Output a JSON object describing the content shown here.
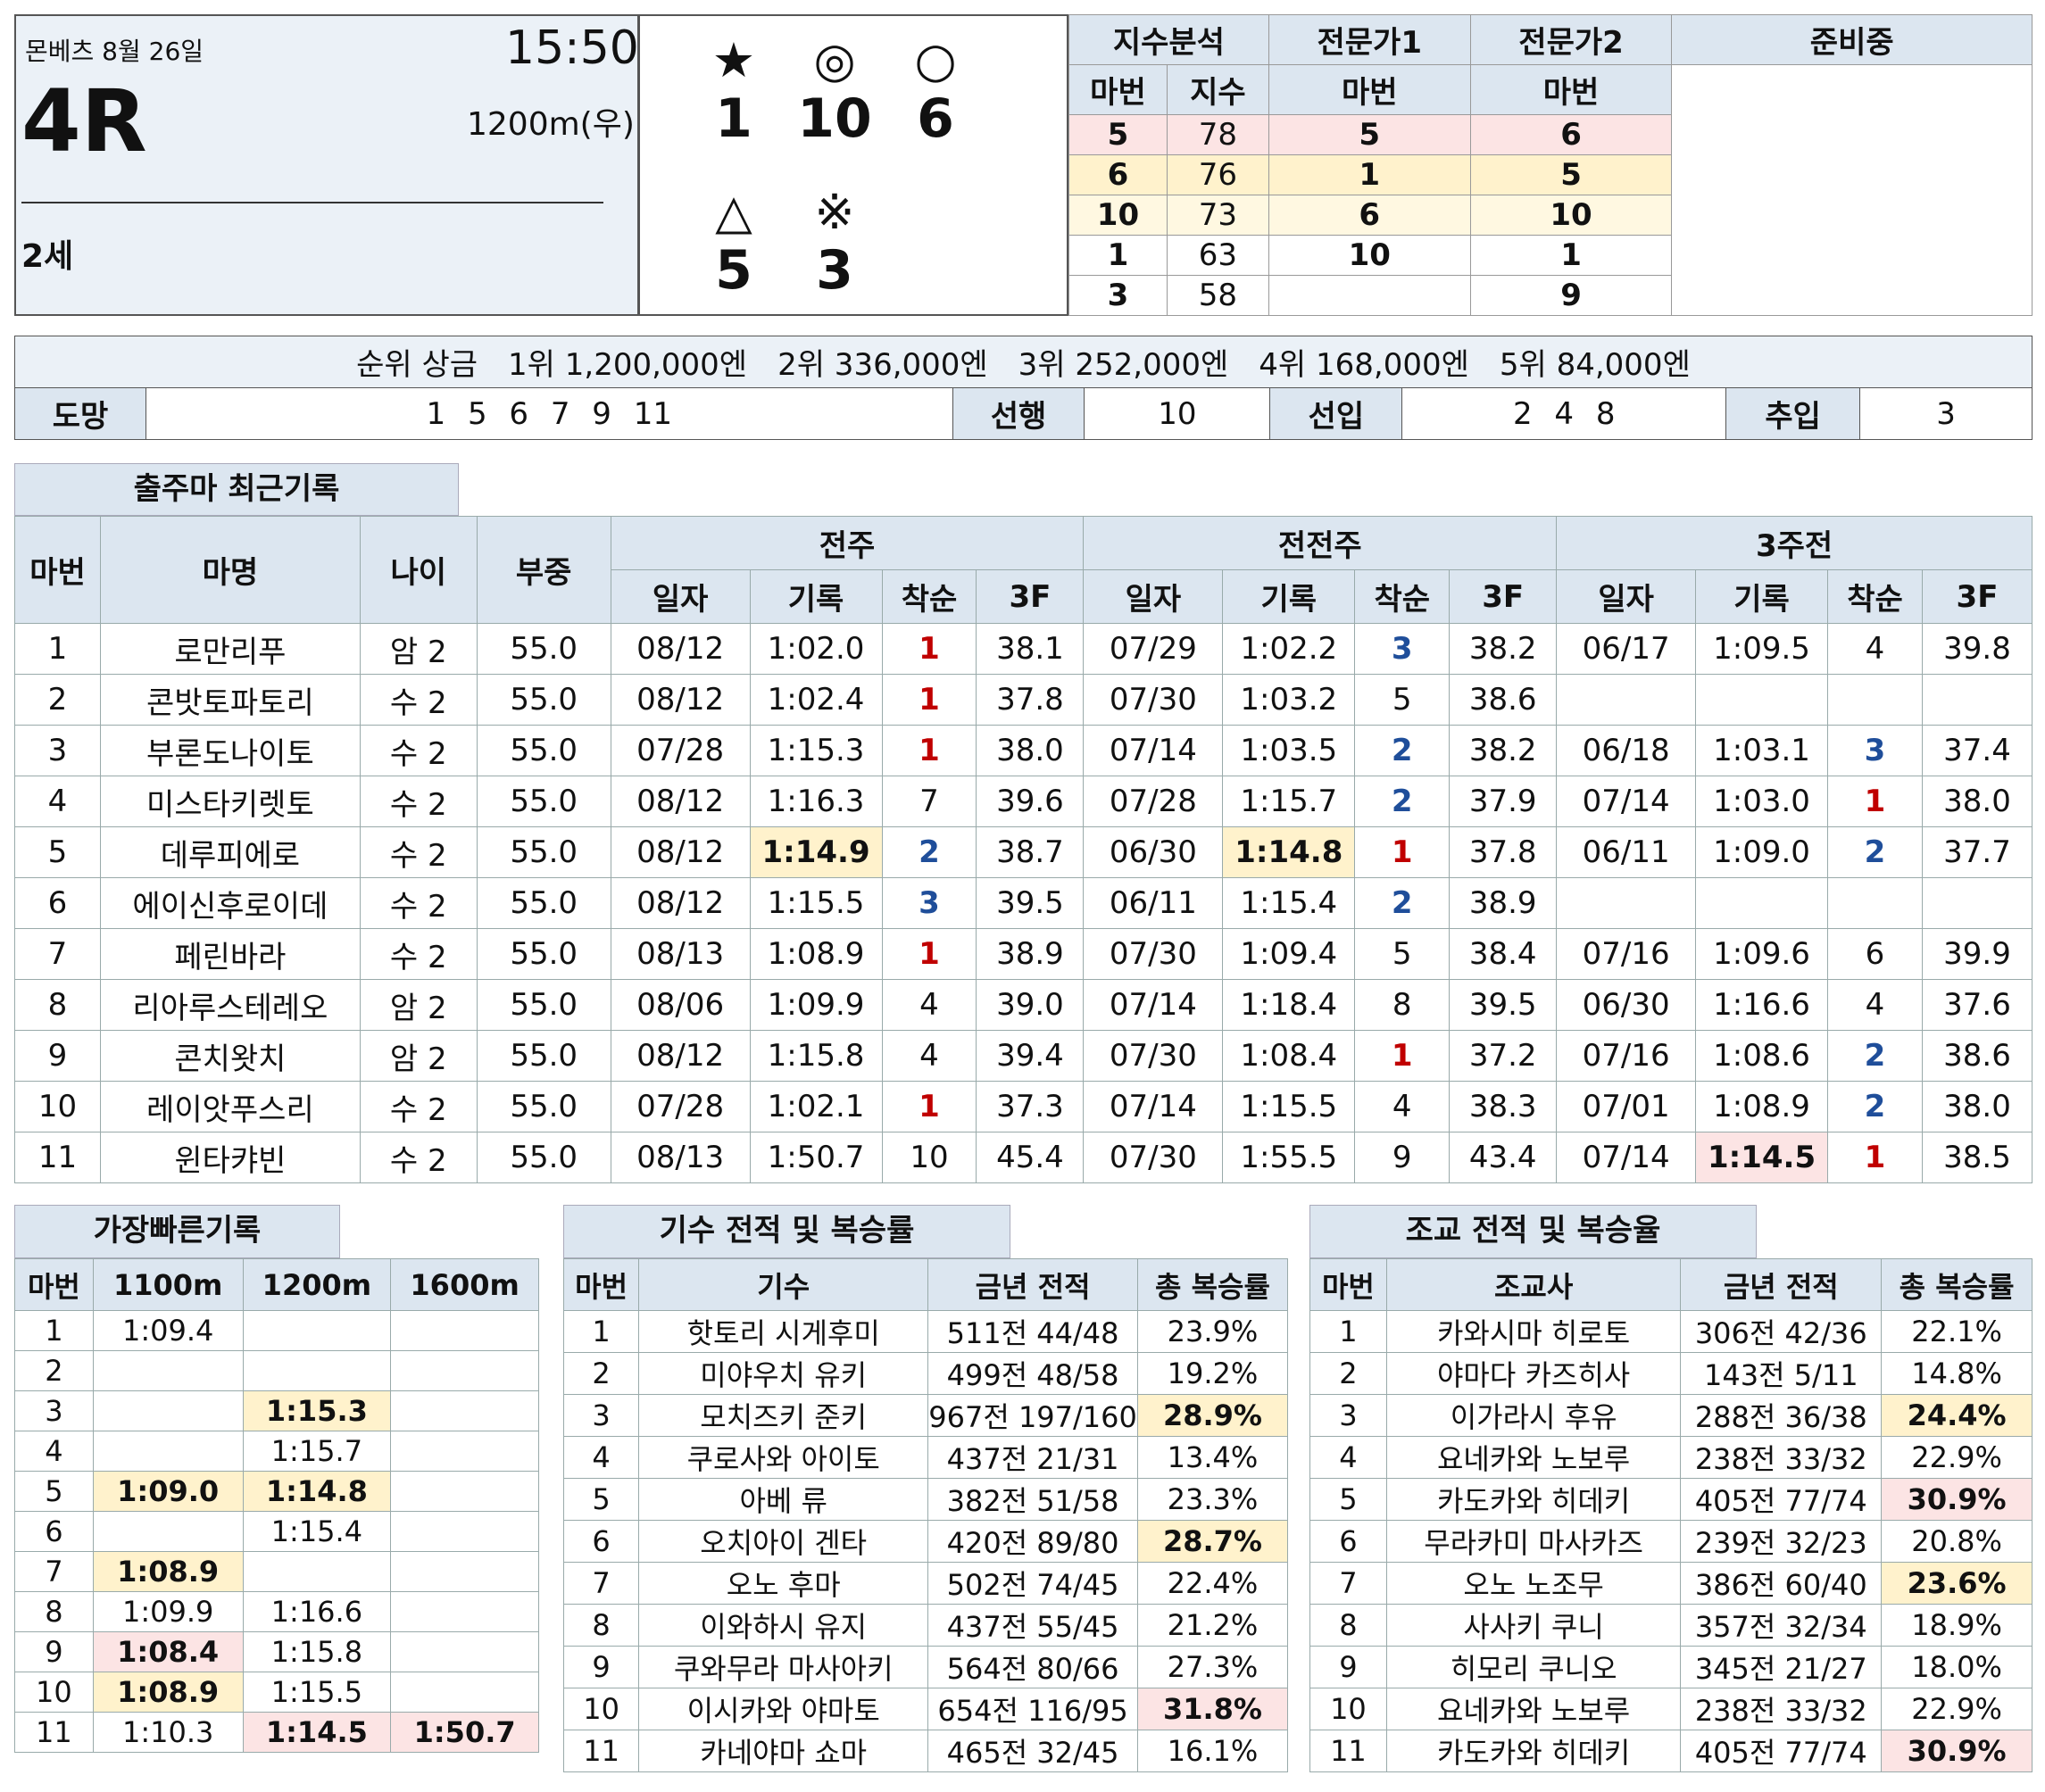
{
  "race": {
    "venue_date": "몬베츠 8월 26일",
    "time": "15:50",
    "race_no": "4R",
    "distance": "1200m(우)",
    "age": "2세"
  },
  "picks": {
    "star_symbol": "★",
    "star_num": "1",
    "double_circle_symbol": "◎",
    "double_circle_num": "10",
    "circle_symbol": "○",
    "circle_num": "6",
    "triangle_symbol": "△",
    "triangle_num": "5",
    "ref_symbol": "※",
    "ref_num": "3"
  },
  "analysis": {
    "headers": [
      "지수분석",
      "전문가1",
      "전문가2",
      "준비중"
    ],
    "sub_headers": [
      "마번",
      "지수",
      "마번",
      "마번"
    ],
    "rows": [
      [
        "5",
        "78",
        "5",
        "6"
      ],
      [
        "6",
        "76",
        "1",
        "5"
      ],
      [
        "10",
        "73",
        "6",
        "10"
      ],
      [
        "1",
        "63",
        "10",
        "1"
      ],
      [
        "3",
        "58",
        "",
        "9"
      ]
    ]
  },
  "prize": {
    "text": "순위 상금　1위 1,200,000엔　2위 336,000엔　3위 252,000엔　4위 168,000엔　5위 84,000엔"
  },
  "pace": {
    "escape_label": "도망",
    "escape_value": "1 5 6 7 9 11",
    "lead_label": "선행",
    "lead_value": "10",
    "stalk_label": "선입",
    "stalk_value": "2 4 8",
    "close_label": "추입",
    "close_value": "3"
  },
  "recent": {
    "title": "출주마 최근기록",
    "col_no": "마번",
    "col_name": "마명",
    "col_age": "나이",
    "col_weight": "부중",
    "period1": "전주",
    "period2": "전전주",
    "period3": "3주전",
    "sub": [
      "일자",
      "기록",
      "착순",
      "3F"
    ],
    "rows": [
      [
        "1",
        "로만리푸",
        "암 2",
        "55.0",
        "08/12",
        "1:02.0",
        "1",
        "38.1",
        "07/29",
        "1:02.2",
        "3",
        "38.2",
        "06/17",
        "1:09.5",
        "4",
        "39.8"
      ],
      [
        "2",
        "콘밧토파토리",
        "수 2",
        "55.0",
        "08/12",
        "1:02.4",
        "1",
        "37.8",
        "07/30",
        "1:03.2",
        "5",
        "38.6",
        "",
        "",
        "",
        ""
      ],
      [
        "3",
        "부론도나이토",
        "수 2",
        "55.0",
        "07/28",
        "1:15.3",
        "1",
        "38.0",
        "07/14",
        "1:03.5",
        "2",
        "38.2",
        "06/18",
        "1:03.1",
        "3",
        "37.4"
      ],
      [
        "4",
        "미스타키렛토",
        "수 2",
        "55.0",
        "08/12",
        "1:16.3",
        "7",
        "39.6",
        "07/28",
        "1:15.7",
        "2",
        "37.9",
        "07/14",
        "1:03.0",
        "1",
        "38.0"
      ],
      [
        "5",
        "데루피에로",
        "수 2",
        "55.0",
        "08/12",
        "1:14.9",
        "2",
        "38.7",
        "06/30",
        "1:14.8",
        "1",
        "37.8",
        "06/11",
        "1:09.0",
        "2",
        "37.7"
      ],
      [
        "6",
        "에이신후로이데",
        "수 2",
        "55.0",
        "08/12",
        "1:15.5",
        "3",
        "39.5",
        "06/11",
        "1:15.4",
        "2",
        "38.9",
        "",
        "",
        "",
        ""
      ],
      [
        "7",
        "페린바라",
        "수 2",
        "55.0",
        "08/13",
        "1:08.9",
        "1",
        "38.9",
        "07/30",
        "1:09.4",
        "5",
        "38.4",
        "07/16",
        "1:09.6",
        "6",
        "39.9"
      ],
      [
        "8",
        "리아루스테레오",
        "암 2",
        "55.0",
        "08/06",
        "1:09.9",
        "4",
        "39.0",
        "07/14",
        "1:18.4",
        "8",
        "39.5",
        "06/30",
        "1:16.6",
        "4",
        "37.6"
      ],
      [
        "9",
        "콘치왓치",
        "암 2",
        "55.0",
        "08/12",
        "1:15.8",
        "4",
        "39.4",
        "07/30",
        "1:08.4",
        "1",
        "37.2",
        "07/16",
        "1:08.6",
        "2",
        "38.6"
      ],
      [
        "10",
        "레이앗푸스리",
        "수 2",
        "55.0",
        "07/28",
        "1:02.1",
        "1",
        "37.3",
        "07/14",
        "1:15.5",
        "4",
        "38.3",
        "07/01",
        "1:08.9",
        "2",
        "38.0"
      ],
      [
        "11",
        "윈타캬빈",
        "수 2",
        "55.0",
        "08/13",
        "1:50.7",
        "10",
        "45.4",
        "07/30",
        "1:55.5",
        "9",
        "43.4",
        "07/14",
        "1:14.5",
        "1",
        "38.5"
      ]
    ]
  },
  "fastest": {
    "title": "가장빠른기록",
    "headers": [
      "마번",
      "1100m",
      "1200m",
      "1600m"
    ],
    "rows": [
      [
        "1",
        "1:09.4",
        "",
        ""
      ],
      [
        "2",
        "",
        "",
        ""
      ],
      [
        "3",
        "",
        "1:15.3",
        ""
      ],
      [
        "4",
        "",
        "1:15.7",
        ""
      ],
      [
        "5",
        "1:09.0",
        "1:14.8",
        ""
      ],
      [
        "6",
        "",
        "1:15.4",
        ""
      ],
      [
        "7",
        "1:08.9",
        "",
        ""
      ],
      [
        "8",
        "1:09.9",
        "1:16.6",
        ""
      ],
      [
        "9",
        "1:08.4",
        "1:15.8",
        ""
      ],
      [
        "10",
        "1:08.9",
        "1:15.5",
        ""
      ],
      [
        "11",
        "1:10.3",
        "1:14.5",
        "1:50.7"
      ]
    ]
  },
  "jockey": {
    "title": "기수 전적 및 복승률",
    "headers": [
      "마번",
      "기수",
      "금년 전적",
      "총 복승률"
    ],
    "rows": [
      [
        "1",
        "핫토리 시게후미",
        "511전 44/48",
        "23.9%"
      ],
      [
        "2",
        "미야우치 유키",
        "499전 48/58",
        "19.2%"
      ],
      [
        "3",
        "모치즈키 준키",
        "967전 197/160",
        "28.9%"
      ],
      [
        "4",
        "쿠로사와 아이토",
        "437전 21/31",
        "13.4%"
      ],
      [
        "5",
        "아베 류",
        "382전 51/58",
        "23.3%"
      ],
      [
        "6",
        "오치아이 겐타",
        "420전 89/80",
        "28.7%"
      ],
      [
        "7",
        "오노 후마",
        "502전 74/45",
        "22.4%"
      ],
      [
        "8",
        "이와하시 유지",
        "437전 55/45",
        "21.2%"
      ],
      [
        "9",
        "쿠와무라 마사아키",
        "564전 80/66",
        "27.3%"
      ],
      [
        "10",
        "이시카와 야마토",
        "654전 116/95",
        "31.8%"
      ],
      [
        "11",
        "카네야마 쇼마",
        "465전 32/45",
        "16.1%"
      ]
    ]
  },
  "trainer": {
    "title": "조교 전적 및 복승율",
    "headers": [
      "마번",
      "조교사",
      "금년 전적",
      "총 복승률"
    ],
    "rows": [
      [
        "1",
        "카와시마 히로토",
        "306전 42/36",
        "22.1%"
      ],
      [
        "2",
        "야마다 카즈히사",
        "143전 5/11",
        "14.8%"
      ],
      [
        "3",
        "이가라시 후유",
        "288전 36/38",
        "24.4%"
      ],
      [
        "4",
        "요네카와 노보루",
        "238전 33/32",
        "22.9%"
      ],
      [
        "5",
        "카도카와 히데키",
        "405전 77/74",
        "30.9%"
      ],
      [
        "6",
        "무라카미 마사카즈",
        "239전 32/23",
        "20.8%"
      ],
      [
        "7",
        "오노 노조무",
        "386전 60/40",
        "23.6%"
      ],
      [
        "8",
        "사사키 쿠니",
        "357전 32/34",
        "18.9%"
      ],
      [
        "9",
        "히모리 쿠니오",
        "345전 21/27",
        "18.0%"
      ],
      [
        "10",
        "요네카와 노보루",
        "238전 33/32",
        "22.9%"
      ],
      [
        "11",
        "카도카와 히데키",
        "405전 77/74",
        "30.9%"
      ]
    ]
  }
}
